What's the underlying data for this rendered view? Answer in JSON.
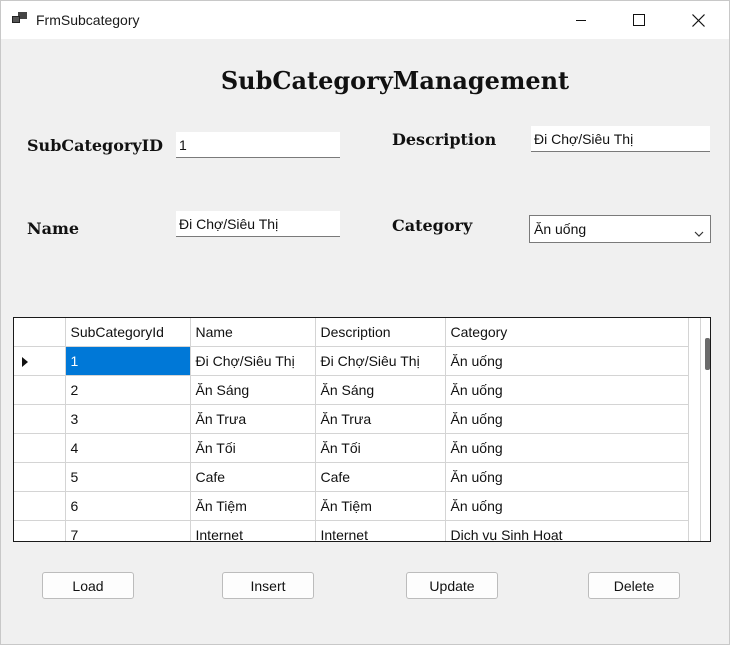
{
  "window": {
    "title": "FrmSubcategory"
  },
  "form": {
    "heading": "SubCategoryManagement",
    "subcategory_id_label": "SubCategoryID",
    "subcategory_id_value": "1",
    "name_label": "Name",
    "name_value": "Đi Chợ/Siêu Thị",
    "description_label": "Description",
    "description_value": "Đi Chợ/Siêu Thị",
    "category_label": "Category",
    "category_value": "Ăn uống"
  },
  "grid": {
    "columns": [
      "SubCategoryId",
      "Name",
      "Description",
      "Category"
    ],
    "rows": [
      [
        "1",
        "Đi Chợ/Siêu Thị",
        "Đi Chợ/Siêu Thị",
        "Ăn uống"
      ],
      [
        "2",
        "Ăn Sáng",
        "Ăn Sáng",
        "Ăn uống"
      ],
      [
        "3",
        "Ăn Trưa",
        "Ăn Trưa",
        "Ăn uống"
      ],
      [
        "4",
        "Ăn Tối",
        "Ăn Tối",
        "Ăn uống"
      ],
      [
        "5",
        "Cafe",
        "Cafe",
        "Ăn uống"
      ],
      [
        "6",
        "Ăn Tiệm",
        "Ăn Tiệm",
        "Ăn uống"
      ],
      [
        "7",
        "Internet",
        "Internet",
        "Dịch vụ Sinh Hoạt"
      ]
    ]
  },
  "buttons": {
    "load": "Load",
    "insert": "Insert",
    "update": "Update",
    "delete": "Delete"
  }
}
